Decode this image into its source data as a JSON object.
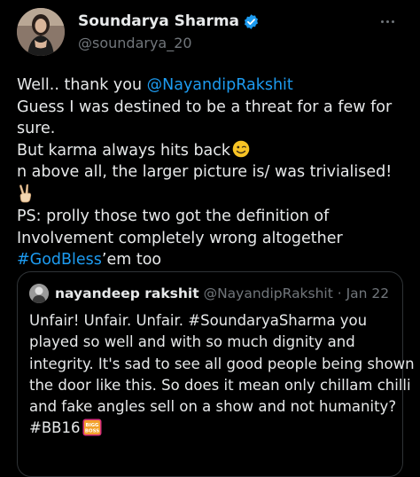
{
  "author": {
    "name": "Soundarya Sharma",
    "handle": "@soundarya_20"
  },
  "post": {
    "line1_prefix": "Well.. thank you ",
    "line1_mention": "@NayandipRakshit",
    "line2": "Guess I was destined to be a threat for a few for",
    "line3": "sure.",
    "line4": "But karma always hits back",
    "line5": "n above all, the larger picture is/ was trivialised!",
    "line7": "PS: prolly those two got the definition of",
    "line8": "Involvement completely wrong altogether",
    "line9_hashtag": "#GodBless",
    "line9_suffix": "’em too"
  },
  "quoted": {
    "name": "nayandeep rakshit",
    "handle": "@NayandipRakshit",
    "separator": " · ",
    "date": "Jan 22",
    "lines": [
      "Unfair! Unfair. Unfair. #SoundaryaSharma you",
      "played so well and with so much dignity and",
      "integrity. It's sad to see all good people being shown",
      "the door like this. So does it mean only chillam chilli",
      "and fake angles sell on a show and not humanity?"
    ],
    "last_line": "#BB16",
    "badge_text": "BIGG BOSS"
  },
  "icons": {
    "verified": "verified-badge-icon",
    "more": "more-icon",
    "wink": "winking-face-emoji",
    "victory": "victory-hand-emoji",
    "badge": "bigg-boss-logo"
  },
  "colors": {
    "background": "#000000",
    "text": "#e7e9ea",
    "secondary": "#71767b",
    "link": "#1d9bf0",
    "border": "#2f3336"
  }
}
